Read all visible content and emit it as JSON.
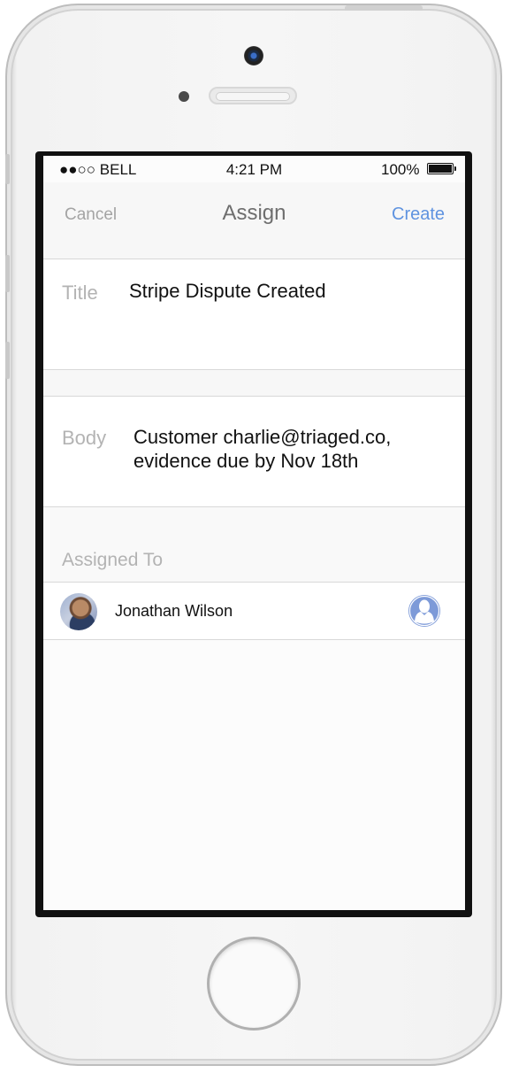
{
  "status_bar": {
    "carrier": "●●○○ BELL",
    "time": "4:21 PM",
    "battery": "100%"
  },
  "nav": {
    "cancel_label": "Cancel",
    "title": "Assign",
    "create_label": "Create"
  },
  "form": {
    "title_label": "Title",
    "title_value": "Stripe Dispute Created",
    "body_label": "Body",
    "body_line1": "Customer charlie@triaged.co,",
    "body_line2": "evidence due by Nov 18th"
  },
  "assigned": {
    "header": "Assigned To",
    "name": "Jonathan Wilson"
  },
  "colors": {
    "accent": "#5f93e0",
    "placeholder": "#b3b3b3",
    "icon": "#7d9ad8"
  },
  "icons": {
    "assignee_action": "person-icon"
  }
}
